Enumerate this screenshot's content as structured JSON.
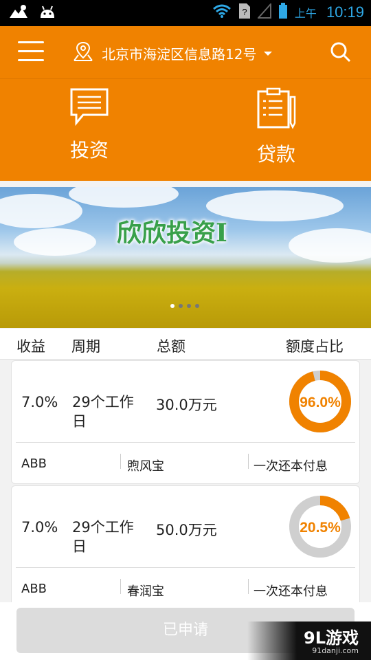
{
  "status_bar": {
    "ampm": "上午",
    "time": "10:19"
  },
  "top_bar": {
    "location": "北京市海淀区信息路12号"
  },
  "actions": [
    {
      "label": "投资"
    },
    {
      "label": "贷款"
    }
  ],
  "banner": {
    "title": "欣欣投资I",
    "page_count": 4,
    "active_page": 1
  },
  "table_header": {
    "yield": "收益",
    "period": "周期",
    "total": "总额",
    "ratio": "额度占比"
  },
  "products": [
    {
      "rate": "7.0%",
      "period": "29个工作日",
      "total": "30.0万元",
      "ratio_text": "96.0%",
      "ratio_value": 0.96,
      "company": "ABB",
      "name": "煦风宝",
      "repayment": "一次还本付息"
    },
    {
      "rate": "7.0%",
      "period": "29个工作日",
      "total": "50.0万元",
      "ratio_text": "20.5%",
      "ratio_value": 0.205,
      "company": "ABB",
      "name": "春润宝",
      "repayment": "一次还本付息"
    }
  ],
  "bottom": {
    "apply_label": "已申请"
  },
  "watermark": {
    "main": "9L游戏",
    "sub": "91danji.com"
  },
  "colors": {
    "primary": "#f08200",
    "donut_track": "#cfcfcf",
    "button_disabled": "#dcdcdc"
  }
}
